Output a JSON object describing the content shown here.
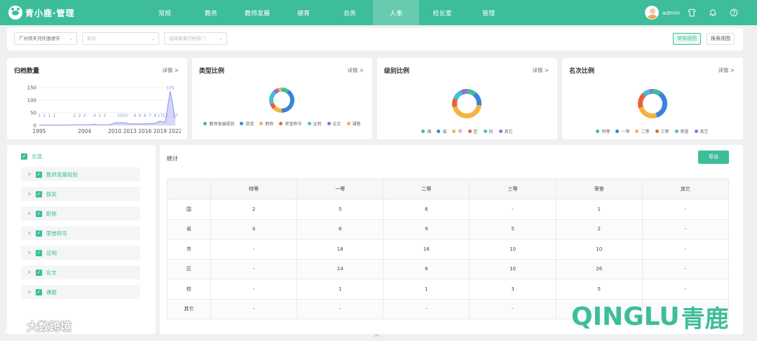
{
  "app": {
    "logo_text": "青小鹿·管理"
  },
  "nav": {
    "items": [
      {
        "label": "常规",
        "active": false
      },
      {
        "label": "教务",
        "active": false
      },
      {
        "label": "教师发展",
        "active": false
      },
      {
        "label": "德育",
        "active": false
      },
      {
        "label": "总务",
        "active": false
      },
      {
        "label": "人事",
        "active": true
      },
      {
        "label": "校长室",
        "active": false
      },
      {
        "label": "管理",
        "active": false
      }
    ]
  },
  "user": {
    "name": "admin"
  },
  "icons": {
    "shirt": "shirt-icon",
    "bell": "bell-icon",
    "help": "help-icon"
  },
  "filters": {
    "school": "广州伟天河外国语学",
    "year_placeholder": "年份",
    "dept_placeholder": "选择备案归档部门",
    "view_normal": "常规视图",
    "view_report": "报表视图"
  },
  "cards": {
    "archive": {
      "title": "归档数量",
      "detail": "详情 >"
    },
    "type": {
      "title": "类型比例",
      "detail": "详情 >",
      "legend": [
        {
          "name": "教师发展规划",
          "color": "#3dbd9a"
        },
        {
          "name": "获奖",
          "color": "#3b82d9"
        },
        {
          "name": "职称",
          "color": "#f4b43f"
        },
        {
          "name": "荣誉称号",
          "color": "#e8613a"
        },
        {
          "name": "证明",
          "color": "#42c1d6"
        },
        {
          "name": "论文",
          "color": "#9b6bd6"
        },
        {
          "name": "课题",
          "color": "#f4b43f"
        }
      ]
    },
    "level": {
      "title": "级别比例",
      "detail": "详情 >",
      "legend": [
        {
          "name": "国",
          "color": "#3dbd9a"
        },
        {
          "name": "省",
          "color": "#3b82d9"
        },
        {
          "name": "市",
          "color": "#f4b43f"
        },
        {
          "name": "区",
          "color": "#e8613a"
        },
        {
          "name": "校",
          "color": "#42c1d6"
        },
        {
          "name": "其它",
          "color": "#9b6bd6"
        }
      ]
    },
    "rank": {
      "title": "名次比例",
      "detail": "详情 >",
      "legend": [
        {
          "name": "特等",
          "color": "#3dbd9a"
        },
        {
          "name": "一等",
          "color": "#3b82d9"
        },
        {
          "name": "二等",
          "color": "#f4b43f"
        },
        {
          "name": "三等",
          "color": "#e8613a"
        },
        {
          "name": "荣誉",
          "color": "#42c1d6"
        },
        {
          "name": "其它",
          "color": "#9b6bd6"
        }
      ]
    }
  },
  "chart_data": [
    {
      "type": "area",
      "x": [
        1995,
        1996,
        1997,
        1998,
        1999,
        2000,
        2001,
        2002,
        2003,
        2004,
        2005,
        2006,
        2007,
        2008,
        2009,
        2010,
        2011,
        2012,
        2013,
        2014,
        2015,
        2016,
        2017,
        2018,
        2019,
        2020,
        2021,
        2022
      ],
      "values": [
        1,
        1,
        1,
        1,
        1,
        1,
        1,
        2,
        2,
        2,
        2,
        4,
        1,
        2,
        2,
        10,
        10,
        10,
        6,
        6,
        6,
        6,
        7,
        8,
        17,
        12,
        135,
        27
      ],
      "labels": [
        "1",
        "1",
        "1",
        "1",
        "1",
        "1",
        "1",
        "2",
        "2",
        "2",
        "2",
        "4",
        "1",
        "2",
        "2",
        "10",
        "10",
        "10",
        "6",
        "6",
        "6",
        "6",
        "7",
        "8",
        "17",
        "12",
        "135",
        "27"
      ],
      "label_indices": [
        0,
        1,
        2,
        3,
        7,
        8,
        9,
        11,
        12,
        13,
        16,
        17,
        19,
        20,
        21,
        22,
        23,
        24,
        25,
        26,
        27
      ],
      "x_ticks": [
        1995,
        2004,
        2010,
        2013,
        2016,
        2019,
        2022
      ],
      "y_ticks": [
        0,
        50,
        100,
        150
      ],
      "ylim": [
        0,
        150
      ],
      "grid": true,
      "color": "#8a93e6"
    },
    {
      "type": "pie",
      "categories": [
        "教师发展规划",
        "获奖",
        "职称",
        "荣誉称号",
        "证明",
        "论文",
        "课题"
      ],
      "values": [
        10,
        40,
        12,
        8,
        18,
        7,
        5
      ],
      "colors": [
        "#3dbd9a",
        "#3b82d9",
        "#f4b43f",
        "#e8613a",
        "#42c1d6",
        "#9b6bd6",
        "#f4b43f"
      ]
    },
    {
      "type": "pie",
      "categories": [
        "国",
        "省",
        "市",
        "区",
        "校",
        "其它"
      ],
      "values": [
        11,
        16,
        44,
        10,
        12,
        7
      ],
      "colors": [
        "#3dbd9a",
        "#3b82d9",
        "#f4b43f",
        "#e8613a",
        "#42c1d6",
        "#9b6bd6"
      ]
    },
    {
      "type": "pie",
      "categories": [
        "特等",
        "一等",
        "二等",
        "三等",
        "荣誉",
        "其它"
      ],
      "values": [
        10,
        35,
        25,
        18,
        8,
        4
      ],
      "colors": [
        "#3dbd9a",
        "#3b82d9",
        "#f4b43f",
        "#e8613a",
        "#42c1d6",
        "#9b6bd6"
      ]
    }
  ],
  "tree": {
    "all_label": "全选",
    "items": [
      "教师发展规划",
      "获奖",
      "职称",
      "荣誉称号",
      "证明",
      "论文",
      "课题"
    ]
  },
  "stats": {
    "title": "统计",
    "export_label": "导出",
    "columns": [
      "特等",
      "一等",
      "二等",
      "三等",
      "荣誉",
      "其它"
    ],
    "rows": [
      {
        "label": "国",
        "cells": [
          "2",
          "5",
          "6",
          "-",
          "1",
          "-"
        ]
      },
      {
        "label": "省",
        "cells": [
          "4",
          "8",
          "9",
          "5",
          "2",
          "-"
        ]
      },
      {
        "label": "市",
        "cells": [
          "-",
          "18",
          "16",
          "10",
          "10",
          "-"
        ]
      },
      {
        "label": "区",
        "cells": [
          "-",
          "14",
          "6",
          "10",
          "26",
          "-"
        ]
      },
      {
        "label": "校",
        "cells": [
          "-",
          "1",
          "1",
          "3",
          "5",
          "-"
        ]
      },
      {
        "label": "其它",
        "cells": [
          "-",
          "-",
          "-",
          "-",
          "-",
          "-"
        ]
      }
    ]
  },
  "watermarks": {
    "left": "大数跨境",
    "right_latin": "QINGLU",
    "right_cn": "青鹿"
  }
}
